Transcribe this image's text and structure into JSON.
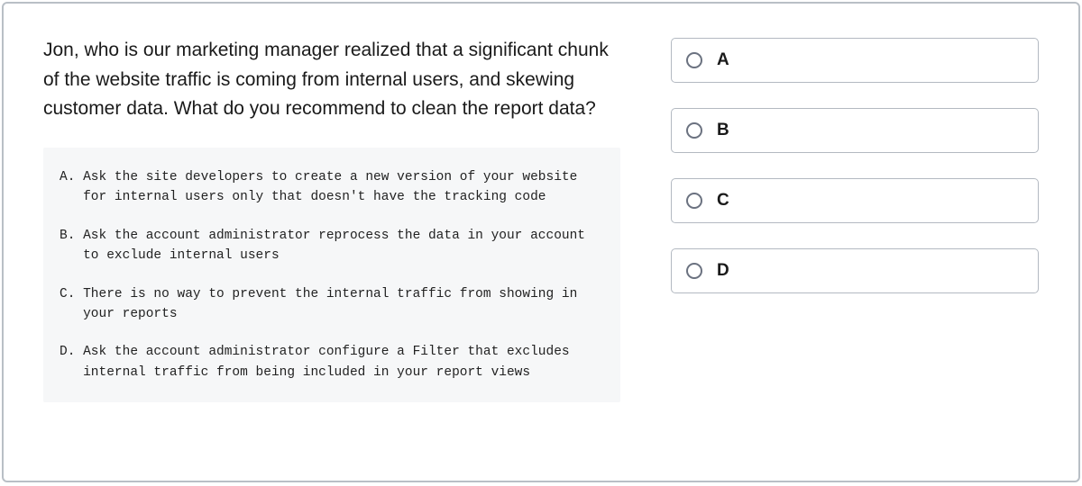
{
  "question": "Jon, who is our marketing manager realized that a significant chunk of the website traffic is coming from internal users, and skewing customer data. What do you recommend to clean the report data?",
  "options": [
    {
      "letter": "A. ",
      "text": "Ask the site developers to create a new version of your website for internal users only that doesn't have the tracking code"
    },
    {
      "letter": "B. ",
      "text": "Ask the account administrator reprocess the data in your account to exclude internal users"
    },
    {
      "letter": "C. ",
      "text": "There is no way to prevent the internal traffic from showing in your reports"
    },
    {
      "letter": "D. ",
      "text": "Ask the account administrator configure a Filter that excludes internal traffic from being included in your report views"
    }
  ],
  "choices": [
    {
      "label": "A"
    },
    {
      "label": "B"
    },
    {
      "label": "C"
    },
    {
      "label": "D"
    }
  ]
}
